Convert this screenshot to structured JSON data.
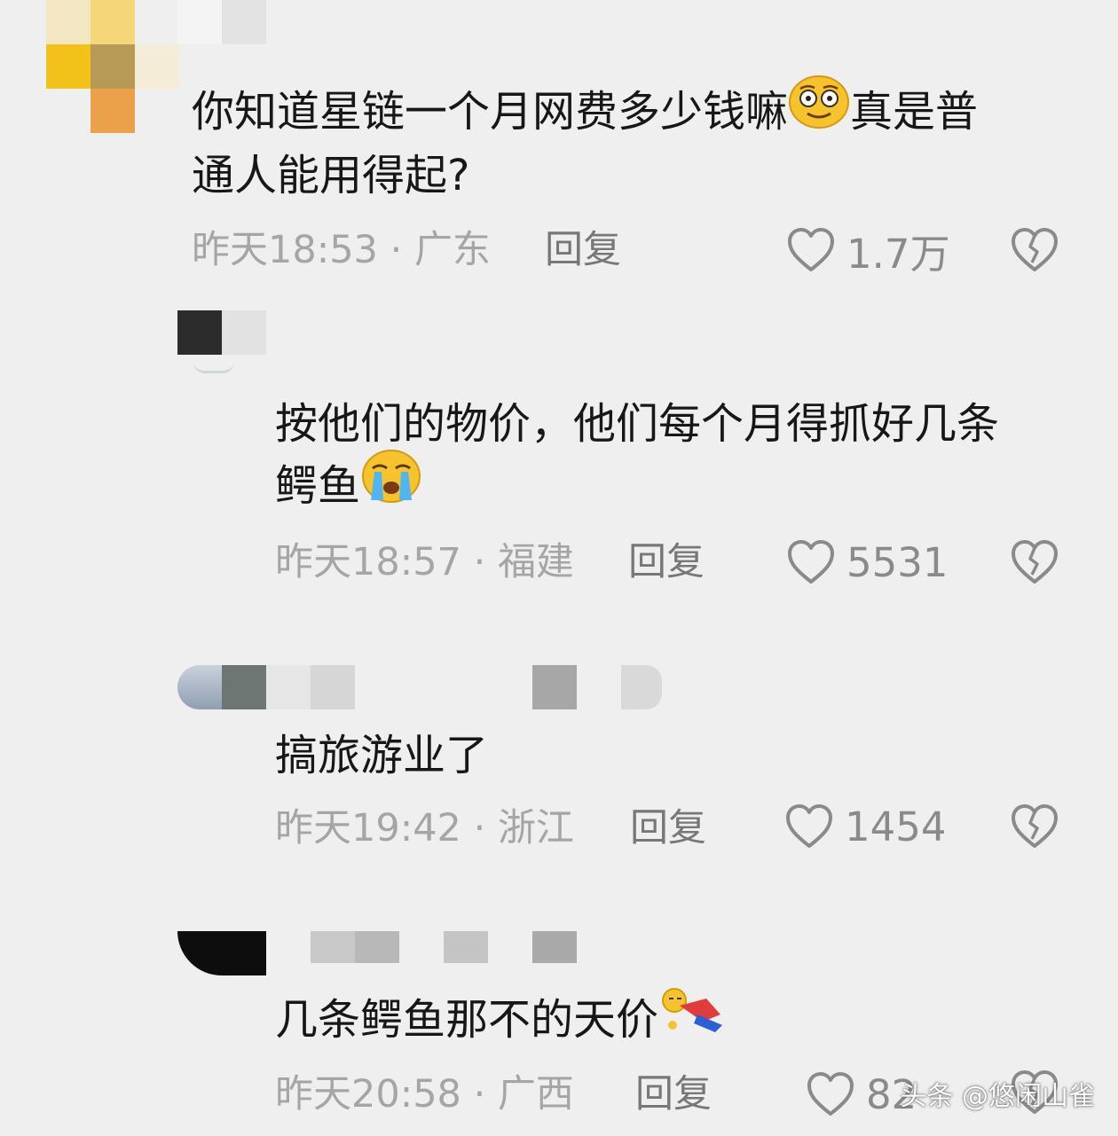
{
  "comments": [
    {
      "text_line1": "你知道星链一个月网费多少钱嘛",
      "text_line1_tail": "真是普",
      "text_line2": "通人能用得起?",
      "emoji": "smirk-face-emoji",
      "time": "昨天18:53",
      "location": "广东",
      "reply_label": "回复",
      "likes": "1.7万"
    },
    {
      "text_line1": "按他们的物价，他们每个月得抓好几条",
      "text_line2": "鳄鱼",
      "emoji": "crying-face-emoji",
      "time": "昨天18:57",
      "location": "福建",
      "reply_label": "回复",
      "likes": "5531"
    },
    {
      "text_line1": "搞旅游业了",
      "time": "昨天19:42",
      "location": "浙江",
      "reply_label": "回复",
      "likes": "1454"
    },
    {
      "text_line1": "几条鳄鱼那不的天价",
      "emoji": "collapsed-person-emoji",
      "time": "昨天20:58",
      "location": "广西",
      "reply_label": "回复",
      "likes": "82"
    }
  ],
  "separator": " · ",
  "watermark": "头条 @悠闲山雀",
  "colors": {
    "background": "#efefef",
    "text": "#171717",
    "meta": "#a5a5a5",
    "reply": "#777777",
    "icon": "#8a8a8a"
  }
}
